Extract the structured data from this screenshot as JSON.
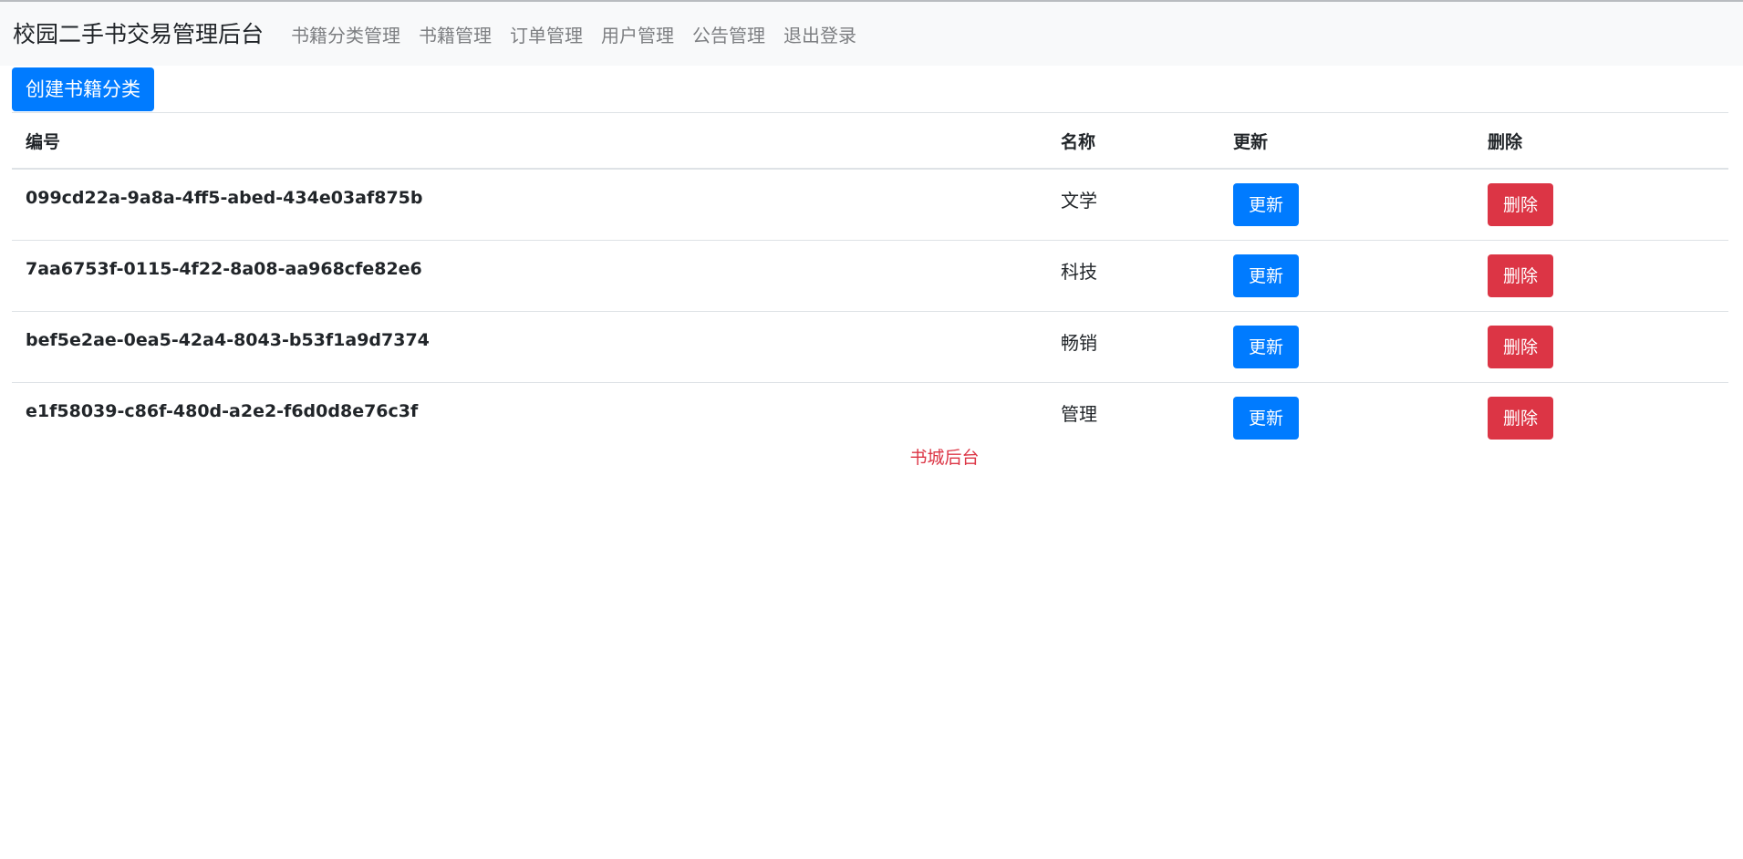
{
  "navbar": {
    "brand": "校园二手书交易管理后台",
    "links": [
      {
        "label": "书籍分类管理"
      },
      {
        "label": "书籍管理"
      },
      {
        "label": "订单管理"
      },
      {
        "label": "用户管理"
      },
      {
        "label": "公告管理"
      },
      {
        "label": "退出登录"
      }
    ]
  },
  "toolbar": {
    "create_label": "创建书籍分类"
  },
  "table": {
    "headers": [
      "编号",
      "名称",
      "更新",
      "删除"
    ],
    "rows": [
      {
        "id": "099cd22a-9a8a-4ff5-abed-434e03af875b",
        "name": "文学",
        "update_label": "更新",
        "delete_label": "删除"
      },
      {
        "id": "7aa6753f-0115-4f22-8a08-aa968cfe82e6",
        "name": "科技",
        "update_label": "更新",
        "delete_label": "删除"
      },
      {
        "id": "bef5e2ae-0ea5-42a4-8043-b53f1a9d7374",
        "name": "畅销",
        "update_label": "更新",
        "delete_label": "删除"
      },
      {
        "id": "e1f58039-c86f-480d-a2e2-f6d0d8e76c3f",
        "name": "管理",
        "update_label": "更新",
        "delete_label": "删除"
      }
    ]
  },
  "footer": {
    "text": "书城后台"
  },
  "colors": {
    "primary": "#007bff",
    "danger": "#dc3545",
    "navbar_bg": "#f8f9fa",
    "nav_link": "#7d7f82"
  }
}
